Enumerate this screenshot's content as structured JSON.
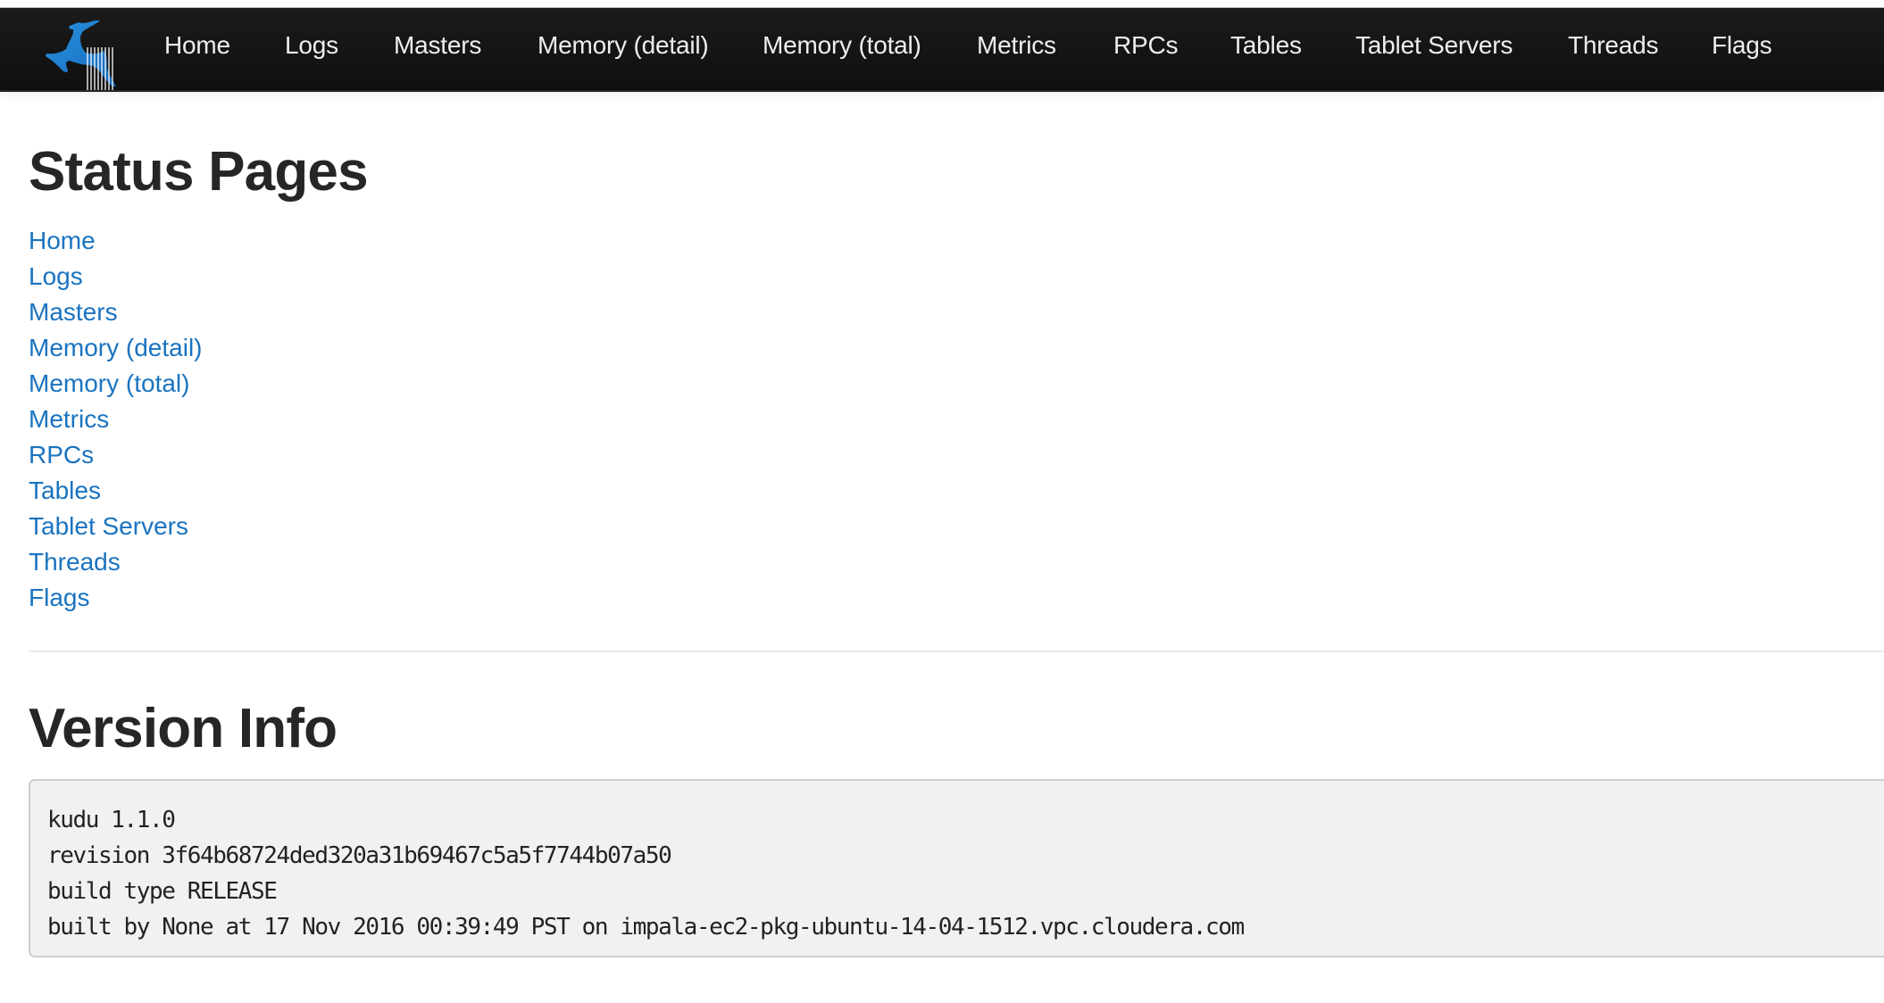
{
  "navbar": {
    "logo": "kudu-antelope-logo",
    "items": [
      {
        "label": "Home"
      },
      {
        "label": "Logs"
      },
      {
        "label": "Masters"
      },
      {
        "label": "Memory (detail)"
      },
      {
        "label": "Memory (total)"
      },
      {
        "label": "Metrics"
      },
      {
        "label": "RPCs"
      },
      {
        "label": "Tables"
      },
      {
        "label": "Tablet Servers"
      },
      {
        "label": "Threads"
      },
      {
        "label": "Flags"
      }
    ]
  },
  "status_pages": {
    "title": "Status Pages",
    "links": [
      {
        "label": "Home"
      },
      {
        "label": "Logs"
      },
      {
        "label": "Masters"
      },
      {
        "label": "Memory (detail)"
      },
      {
        "label": "Memory (total)"
      },
      {
        "label": "Metrics"
      },
      {
        "label": "RPCs"
      },
      {
        "label": "Tables"
      },
      {
        "label": "Tablet Servers"
      },
      {
        "label": "Threads"
      },
      {
        "label": "Flags"
      }
    ]
  },
  "version_info": {
    "title": "Version Info",
    "lines": [
      "kudu 1.1.0",
      "revision 3f64b68724ded320a31b69467c5a5f7744b07a50",
      "build type RELEASE",
      "built by None at 17 Nov 2016 00:39:49 PST on impala-ec2-pkg-ubuntu-14-04-1512.vpc.cloudera.com"
    ]
  },
  "colors": {
    "navbar_bg": "#141414",
    "nav_text": "#eeeeee",
    "link": "#1a73c0",
    "heading": "#262626",
    "pre_bg": "#f1f1f1",
    "logo_blue": "#1e88d8"
  }
}
